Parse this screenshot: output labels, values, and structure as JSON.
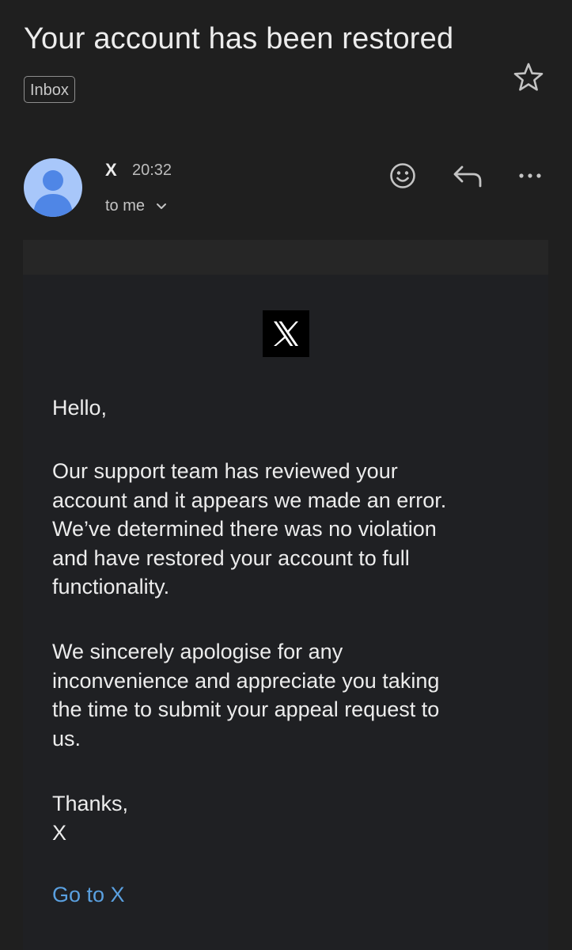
{
  "email": {
    "subject": "Your account has been restored",
    "label": "Inbox",
    "sender": "X",
    "time": "20:32",
    "recipient": "to me"
  },
  "icons": {
    "star": "star-outline-icon",
    "emoji": "smiley-icon",
    "reply": "reply-icon",
    "more": "more-horizontal-icon",
    "avatar": "person-icon",
    "recipient_toggle": "chevron-down-icon",
    "logo": "x-logo"
  },
  "body": {
    "greeting": "Hello,",
    "paragraph_1": "Our support team has reviewed your\naccount and it appears we made an error.\nWe’ve determined there was no violation\nand have restored your account to full\nfunctionality.",
    "paragraph_2": "We sincerely apologise for any\ninconvenience and appreciate you taking\nthe time to submit your appeal request to\nus.",
    "signoff": "Thanks,\nX",
    "cta_label": "Go to X"
  },
  "colors": {
    "background": "#1f1f1f",
    "email_body": "#1f2023",
    "avatar": "#a8c7fa",
    "avatar_glyph": "#4f86e6",
    "link": "#5aa0e0"
  }
}
